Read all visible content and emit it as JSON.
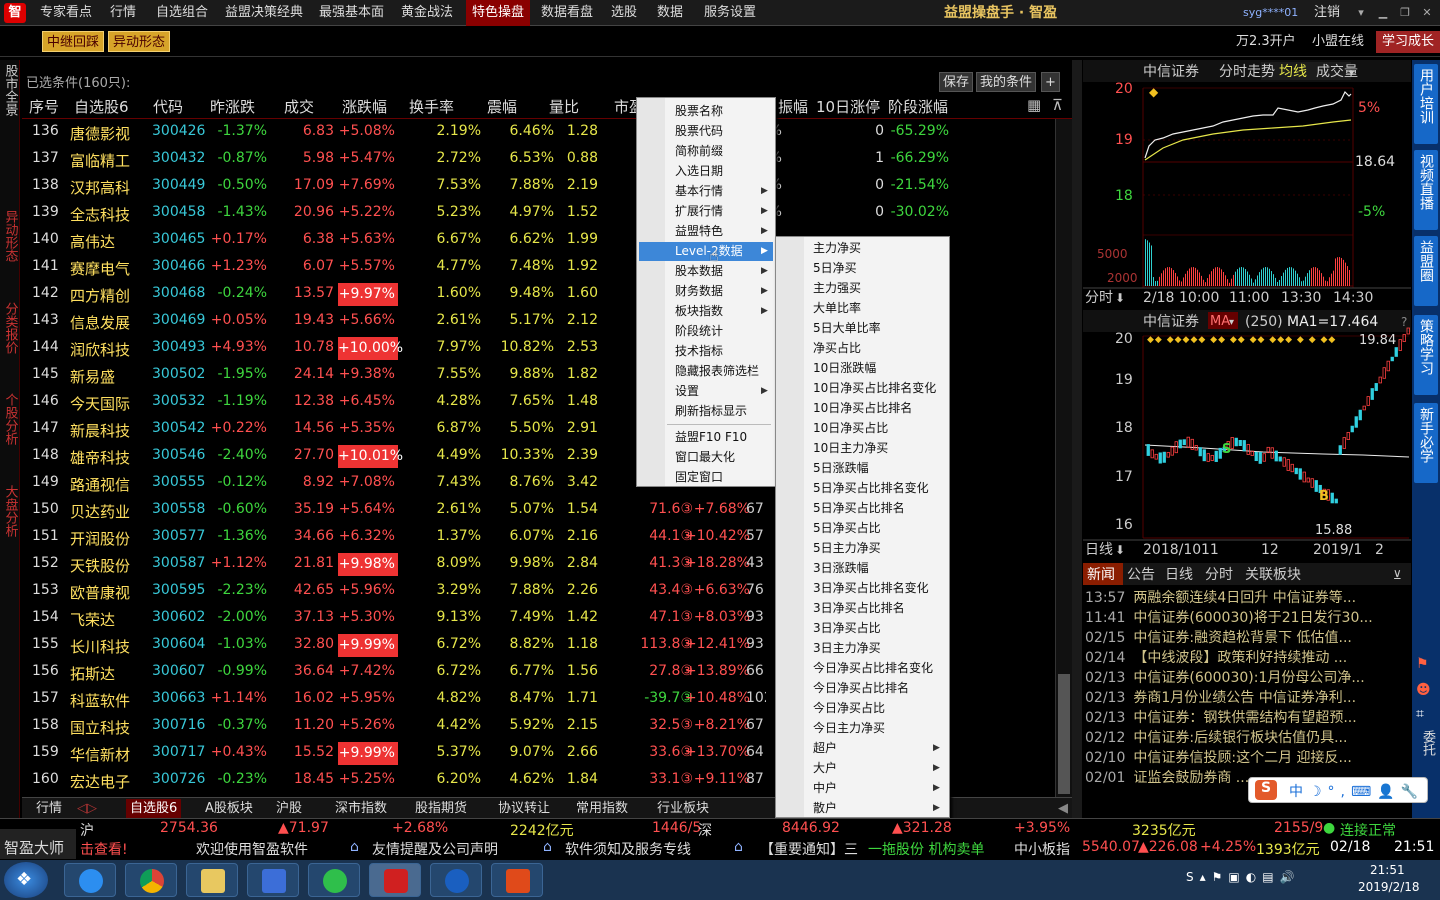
{
  "menubar": {
    "logo": "智",
    "items": [
      "专家看点",
      "行情",
      "自选组合",
      "益盟决策经典",
      "最强基本面",
      "黄金战法",
      "特色操盘",
      "数据看盘",
      "选股",
      "数据",
      "服务设置"
    ],
    "brand": "益盟操盘手 · 智盈",
    "user": "syg****01",
    "logout": "注销"
  },
  "toolbar": {
    "btn1": "中继回踩",
    "btn2": "异动形态",
    "account": "万2.3开户",
    "online": "小盟在线",
    "study": "学习成长"
  },
  "left_tabs": [
    "股市全景",
    "异动形态",
    "分类报价",
    "个股分析",
    "大盘分析"
  ],
  "table": {
    "condition": "已选条件(160只):",
    "save": "保存",
    "mycond": "我的条件",
    "plus": "+",
    "headers": [
      "序号",
      "自选股6",
      "代码",
      "昨涨跌",
      "成交",
      "涨跌幅",
      "换手率",
      "震幅",
      "量比",
      "市盈",
      "振幅",
      "10日涨停",
      "阶段涨幅"
    ],
    "rows": [
      {
        "no": "136",
        "name": "唐德影视",
        "code": "300426",
        "pre": "-1.37%",
        "price": "6.83",
        "chg": "+5.08%",
        "lim": false,
        "turn": "2.19%",
        "amp": "6.46%",
        "vr": "1.28",
        "x1": "",
        "x2": "",
        "x3": "",
        "zb": ".10%",
        "ten": "0",
        "stage": "-65.29%"
      },
      {
        "no": "137",
        "name": "富临精工",
        "code": "300432",
        "pre": "-0.87%",
        "price": "5.98",
        "chg": "+5.47%",
        "lim": false,
        "turn": "2.72%",
        "amp": "6.53%",
        "vr": "0.88",
        "x1": "",
        "x2": "",
        "x3": "",
        "zb": ".47%",
        "ten": "1",
        "stage": "-66.29%"
      },
      {
        "no": "138",
        "name": "汉邦高科",
        "code": "300449",
        "pre": "-0.50%",
        "price": "17.09",
        "chg": "+7.69%",
        "lim": false,
        "turn": "7.53%",
        "amp": "7.88%",
        "vr": "2.19",
        "x1": "",
        "x2": "",
        "x3": "",
        "zb": ".09%",
        "ten": "0",
        "stage": "-21.54%"
      },
      {
        "no": "139",
        "name": "全志科技",
        "code": "300458",
        "pre": "-1.43%",
        "price": "20.96",
        "chg": "+5.22%",
        "lim": false,
        "turn": "5.23%",
        "amp": "4.97%",
        "vr": "1.52",
        "x1": "",
        "x2": "",
        "x3": "",
        "zb": ".82%",
        "ten": "0",
        "stage": "-30.02%"
      },
      {
        "no": "140",
        "name": "高伟达",
        "code": "300465",
        "pre": "+0.17%",
        "price": "6.38",
        "chg": "+5.63%",
        "lim": false,
        "turn": "6.67%",
        "amp": "6.62%",
        "vr": "1.99",
        "x1": "",
        "x2": "",
        "x3": "",
        "zb": "",
        "ten": "",
        "stage": ""
      },
      {
        "no": "141",
        "name": "赛摩电气",
        "code": "300466",
        "pre": "+1.23%",
        "price": "6.07",
        "chg": "+5.57%",
        "lim": false,
        "turn": "4.77%",
        "amp": "7.48%",
        "vr": "1.92",
        "x1": "",
        "x2": "",
        "x3": "",
        "zb": "",
        "ten": "",
        "stage": ""
      },
      {
        "no": "142",
        "name": "四方精创",
        "code": "300468",
        "pre": "-0.24%",
        "price": "13.57",
        "chg": "+9.97%",
        "lim": true,
        "turn": "1.60%",
        "amp": "9.48%",
        "vr": "1.60",
        "x1": "",
        "x2": "",
        "x3": "",
        "zb": "",
        "ten": "",
        "stage": ""
      },
      {
        "no": "143",
        "name": "信息发展",
        "code": "300469",
        "pre": "+0.05%",
        "price": "19.43",
        "chg": "+5.66%",
        "lim": false,
        "turn": "2.61%",
        "amp": "5.17%",
        "vr": "2.12",
        "x1": "",
        "x2": "",
        "x3": "2",
        "zb": "",
        "ten": "",
        "stage": ""
      },
      {
        "no": "144",
        "name": "润欣科技",
        "code": "300493",
        "pre": "+4.93%",
        "price": "10.78",
        "chg": "+10.00%",
        "lim": true,
        "turn": "7.97%",
        "amp": "10.82%",
        "vr": "2.53",
        "x1": "",
        "x2": "",
        "x3": "",
        "zb": "",
        "ten": "",
        "stage": ""
      },
      {
        "no": "145",
        "name": "新易盛",
        "code": "300502",
        "pre": "-1.95%",
        "price": "24.14",
        "chg": "+9.38%",
        "lim": false,
        "turn": "7.55%",
        "amp": "9.88%",
        "vr": "1.82",
        "x1": "",
        "x2": "",
        "x3": "7",
        "zb": "",
        "ten": "",
        "stage": ""
      },
      {
        "no": "146",
        "name": "今天国际",
        "code": "300532",
        "pre": "-1.19%",
        "price": "12.38",
        "chg": "+6.45%",
        "lim": false,
        "turn": "4.28%",
        "amp": "7.65%",
        "vr": "1.48",
        "x1": "",
        "x2": "",
        "x3": "1",
        "zb": "",
        "ten": "",
        "stage": ""
      },
      {
        "no": "147",
        "name": "新晨科技",
        "code": "300542",
        "pre": "+0.22%",
        "price": "14.56",
        "chg": "+5.35%",
        "lim": false,
        "turn": "6.87%",
        "amp": "5.50%",
        "vr": "2.91",
        "x1": "",
        "x2": "",
        "x3": "1",
        "zb": "",
        "ten": "",
        "stage": ""
      },
      {
        "no": "148",
        "name": "雄帝科技",
        "code": "300546",
        "pre": "-2.40%",
        "price": "27.70",
        "chg": "+10.01%",
        "lim": true,
        "turn": "4.49%",
        "amp": "10.33%",
        "vr": "2.39",
        "x1": "",
        "x2": "",
        "x3": "",
        "zb": "",
        "ten": "",
        "stage": ""
      },
      {
        "no": "149",
        "name": "路通视信",
        "code": "300555",
        "pre": "-0.12%",
        "price": "8.92",
        "chg": "+7.08%",
        "lim": false,
        "turn": "7.43%",
        "amp": "8.76%",
        "vr": "3.42",
        "x1": "",
        "x2": "",
        "x3": "",
        "zb": "",
        "ten": "",
        "stage": ""
      },
      {
        "no": "150",
        "name": "贝达药业",
        "code": "300558",
        "pre": "-0.60%",
        "price": "35.19",
        "chg": "+5.64%",
        "lim": false,
        "turn": "2.61%",
        "amp": "5.07%",
        "vr": "1.54",
        "x1": "71.6③",
        "x2": "+7.68%",
        "x3": "67",
        "zb": "",
        "ten": "",
        "stage": ""
      },
      {
        "no": "151",
        "name": "开润股份",
        "code": "300577",
        "pre": "-1.36%",
        "price": "34.66",
        "chg": "+6.32%",
        "lim": false,
        "turn": "1.37%",
        "amp": "6.07%",
        "vr": "2.16",
        "x1": "44.1③",
        "x2": "+10.42%",
        "x3": "57",
        "zb": "",
        "ten": "",
        "stage": ""
      },
      {
        "no": "152",
        "name": "天铁股份",
        "code": "300587",
        "pre": "+1.12%",
        "price": "21.81",
        "chg": "+9.98%",
        "lim": true,
        "turn": "8.09%",
        "amp": "9.98%",
        "vr": "2.84",
        "x1": "41.3③",
        "x2": "+18.28%",
        "x3": "43",
        "zb": "",
        "ten": "",
        "stage": ""
      },
      {
        "no": "153",
        "name": "欧普康视",
        "code": "300595",
        "pre": "-2.23%",
        "price": "42.65",
        "chg": "+5.96%",
        "lim": false,
        "turn": "3.29%",
        "amp": "7.88%",
        "vr": "2.26",
        "x1": "43.4③",
        "x2": "+6.63%",
        "x3": "76",
        "zb": "",
        "ten": "",
        "stage": ""
      },
      {
        "no": "154",
        "name": "飞荣达",
        "code": "300602",
        "pre": "-2.00%",
        "price": "37.13",
        "chg": "+5.30%",
        "lim": false,
        "turn": "9.13%",
        "amp": "7.49%",
        "vr": "1.42",
        "x1": "47.1③",
        "x2": "+8.03%",
        "x3": "93",
        "zb": "",
        "ten": "",
        "stage": ""
      },
      {
        "no": "155",
        "name": "长川科技",
        "code": "300604",
        "pre": "-1.03%",
        "price": "32.80",
        "chg": "+9.99%",
        "lim": true,
        "turn": "6.72%",
        "amp": "8.82%",
        "vr": "1.18",
        "x1": "113.8③",
        "x2": "+12.41%",
        "x3": "93",
        "zb": "",
        "ten": "",
        "stage": ""
      },
      {
        "no": "156",
        "name": "拓斯达",
        "code": "300607",
        "pre": "-0.99%",
        "price": "36.64",
        "chg": "+7.42%",
        "lim": false,
        "turn": "6.72%",
        "amp": "6.77%",
        "vr": "1.56",
        "x1": "27.8③",
        "x2": "+13.89%",
        "x3": "66",
        "zb": "",
        "ten": "",
        "stage": ""
      },
      {
        "no": "157",
        "name": "科蓝软件",
        "code": "300663",
        "pre": "+1.14%",
        "price": "16.02",
        "chg": "+5.95%",
        "lim": false,
        "turn": "4.82%",
        "amp": "8.47%",
        "vr": "1.71",
        "x1": "-39.7③",
        "x2": "+10.48%",
        "x3": "102",
        "zb": "",
        "ten": "",
        "stage": ""
      },
      {
        "no": "158",
        "name": "国立科技",
        "code": "300716",
        "pre": "-0.37%",
        "price": "11.20",
        "chg": "+5.26%",
        "lim": false,
        "turn": "4.42%",
        "amp": "5.92%",
        "vr": "2.15",
        "x1": "32.5③",
        "x2": "+8.21%",
        "x3": "67",
        "zb": "",
        "ten": "",
        "stage": ""
      },
      {
        "no": "159",
        "name": "华信新材",
        "code": "300717",
        "pre": "+0.43%",
        "price": "15.52",
        "chg": "+9.99%",
        "lim": true,
        "turn": "5.37%",
        "amp": "9.07%",
        "vr": "2.66",
        "x1": "33.6③",
        "x2": "+13.70%",
        "x3": "64",
        "zb": "",
        "ten": "",
        "stage": ""
      },
      {
        "no": "160",
        "name": "宏达电子",
        "code": "300726",
        "pre": "-0.23%",
        "price": "18.45",
        "chg": "+5.25%",
        "lim": false,
        "turn": "6.20%",
        "amp": "4.62%",
        "vr": "1.84",
        "x1": "33.1③",
        "x2": "+9.11%",
        "x3": "87",
        "zb": "",
        "ten": "",
        "stage": ""
      }
    ]
  },
  "bottom_tabs": [
    "行情",
    "自选股6",
    "A股板块",
    "沪股",
    "深市指数",
    "股指期货",
    "协议转让",
    "常用指数",
    "行业板块"
  ],
  "context_menu": {
    "items": [
      "股票名称",
      "股票代码",
      "简称前缀",
      "入选日期",
      "基本行情",
      "扩展行情",
      "益盟特色",
      "Level-2数据",
      "股本数据",
      "财务数据",
      "板块指数",
      "阶段统计",
      "技术指标",
      "隐藏报表筛选栏",
      "设置",
      "刷新指标显示",
      "益盟F10    F10",
      "窗口最大化",
      "固定窗口"
    ],
    "submenu": [
      "主力净买",
      "5日净买",
      "主力强买",
      "大单比率",
      "5日大单比率",
      "净买占比",
      "10日涨跌幅",
      "10日净买占比排名变化",
      "10日净买占比排名",
      "10日净买占比",
      "10日主力净买",
      "5日涨跌幅",
      "5日净买占比排名变化",
      "5日净买占比排名",
      "5日净买占比",
      "5日主力净买",
      "3日涨跌幅",
      "3日净买占比排名变化",
      "3日净买占比排名",
      "3日净买占比",
      "3日主力净买",
      "今日净买占比排名变化",
      "今日净买占比排名",
      "今日净买占比",
      "今日主力净买",
      "超户",
      "大户",
      "中户",
      "散户"
    ]
  },
  "intraday": {
    "name": "中信证券",
    "mode": "分时走势",
    "line": "均线",
    "vol": "成交量",
    "y_labels": [
      "20",
      "19",
      "18"
    ],
    "right_labels": [
      "5%",
      "18.64",
      "-5%"
    ],
    "vol_labels": [
      "5000",
      "2000"
    ],
    "x_labels": [
      "分时",
      "2/18",
      "10:00",
      "11:00",
      "13:30",
      "14:30"
    ]
  },
  "kline": {
    "name": "中信证券",
    "ma": "MA",
    "period": "(250)",
    "ma1": "MA1=17.464",
    "y_labels": [
      "20",
      "19",
      "18",
      "17",
      "16"
    ],
    "high": "19.84",
    "low": "15.88",
    "x_labels": [
      "日线",
      "2018/10",
      "11",
      "12",
      "2019/1",
      "2"
    ],
    "s_mark": "S",
    "b_mark": "B",
    "help": "?"
  },
  "news": {
    "tabs": [
      "新闻",
      "公告",
      "日线",
      "分时",
      "关联板块"
    ],
    "items": [
      {
        "t": "13:57",
        "h": "两融余额连续4日回升 中信证券等..."
      },
      {
        "t": "11:41",
        "h": "中信证券(600030)将于21日发行30..."
      },
      {
        "t": "02/15",
        "h": "中信证券:融资趋松背景下 低估值..."
      },
      {
        "t": "02/14",
        "h": "【中线波段】政策利好持续推动 ..."
      },
      {
        "t": "02/13",
        "h": "中信证券(600030):1月份母公司净..."
      },
      {
        "t": "02/13",
        "h": "券商1月份业绩公告 中信证券净利..."
      },
      {
        "t": "02/13",
        "h": "中信证券：钢铁供需结构有望超预..."
      },
      {
        "t": "02/12",
        "h": "中信证券:后续银行板块估值仍具..."
      },
      {
        "t": "02/10",
        "h": "中信证券信投顾:这个二月 迎接反..."
      },
      {
        "t": "02/01",
        "h": "证监会鼓励券商 ..."
      }
    ]
  },
  "right_tabs": [
    "用户培训",
    "视频直播",
    "益盟圈",
    "策略学习",
    "新手必学"
  ],
  "ticker1": {
    "sh": "沪",
    "sh_idx": "2754.36",
    "sh_up": "▲71.97",
    "sh_pct": "+2.68%",
    "sh_amt": "2242亿元",
    "sh_cnt": "1446/5",
    "sz": "深",
    "sz_idx": "8446.92",
    "sz_up": "▲321.28",
    "sz_pct": "+3.95%",
    "sz_amt": "3235亿元",
    "sz_cnt": "2155/9",
    "status": "连接正常"
  },
  "ticker2": {
    "brand": "智盈大师",
    "t0": "击查看!",
    "t1": "欢迎使用智盈软件",
    "t2": "友情提醒及公司声明",
    "t3": "软件须知及服务专线",
    "t4": "【重要通知】三",
    "t5": "一拖股份 机构卖单",
    "t6": "中小板指",
    "t6v": "5540.07",
    "t6u": "▲226.08",
    "t6p": "+4.25%",
    "t6a": "1393亿元",
    "date": "02/18",
    "time": "21:51"
  },
  "taskbar": {
    "time": "21:51",
    "date": "2019/2/18"
  }
}
